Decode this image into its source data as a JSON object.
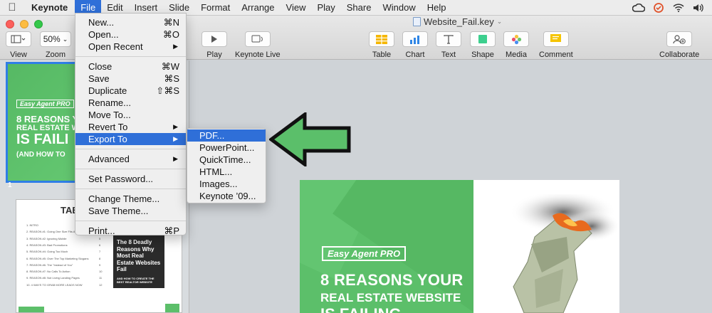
{
  "menubar": {
    "app_name": "Keynote",
    "items": [
      "File",
      "Edit",
      "Insert",
      "Slide",
      "Format",
      "Arrange",
      "View",
      "Play",
      "Share",
      "Window",
      "Help"
    ]
  },
  "window": {
    "document_title": "Website_Fail.key"
  },
  "toolbar": {
    "view_label": "View",
    "zoom_value": "50%",
    "zoom_label": "Zoom",
    "play_label": "Play",
    "keynote_live_label": "Keynote Live",
    "table_label": "Table",
    "chart_label": "Chart",
    "text_label": "Text",
    "shape_label": "Shape",
    "media_label": "Media",
    "comment_label": "Comment",
    "collaborate_label": "Collaborate"
  },
  "file_menu": {
    "items": [
      {
        "label": "New...",
        "shortcut": "⌘N"
      },
      {
        "label": "Open...",
        "shortcut": "⌘O"
      },
      {
        "label": "Open Recent",
        "submenu": true
      },
      {
        "label": "Close",
        "shortcut": "⌘W"
      },
      {
        "label": "Save",
        "shortcut": "⌘S"
      },
      {
        "label": "Duplicate",
        "shortcut": "⇧⌘S"
      },
      {
        "label": "Rename..."
      },
      {
        "label": "Move To..."
      },
      {
        "label": "Revert To",
        "submenu": true
      },
      {
        "label": "Export To",
        "submenu": true,
        "highlighted": true
      },
      {
        "label": "Advanced",
        "submenu": true
      },
      {
        "label": "Set Password..."
      },
      {
        "label": "Change Theme..."
      },
      {
        "label": "Save Theme..."
      },
      {
        "label": "Print...",
        "shortcut": "⌘P"
      }
    ]
  },
  "export_submenu": {
    "items": [
      "PDF...",
      "PowerPoint...",
      "QuickTime...",
      "HTML...",
      "Images...",
      "Keynote ’09..."
    ]
  },
  "slides": {
    "slide1_number": "1",
    "slide1_logo": "Easy Agent PRO",
    "slide1_line1": "8 REASONS YO",
    "slide1_line2": "REAL ESTATE WE",
    "slide1_line3": "IS FAILI",
    "slide1_line4": "(AND HOW TO",
    "slide2_title": "TAB",
    "slide2_toc": [
      "1. INTRO",
      "2. REASON #1: Going One Size Fits All",
      "3. REASON #2: Ignoring Mobile",
      "4. REASON #3: Bad Promotions",
      "5. REASON #4: Going Too Much",
      "6. REASON #5: Over The Top Marketing Slogans",
      "7. REASON #6: The \"Instead of You\"",
      "8. REASON #7: No Calls To Action",
      "9. REASON #8: Not Living Landing Pages",
      "10. 4 WAYS TO GRAB MORE LEADS NOW"
    ],
    "slide2_page_numbers": [
      "3",
      "3",
      "5",
      "6",
      "7",
      "8",
      "9",
      "10",
      "11",
      "12"
    ],
    "slide2_book": "The 8 Deadly Reasons Why Most Real Estate Websites Fail",
    "slide2_book_sub": "AND HOW TO CREATE THE BEST REALTOR WEBSITE"
  },
  "canvas": {
    "logo": "Easy Agent PRO",
    "headline1": "8 REASONS YOUR",
    "headline2": "REAL ESTATE WEBSITE",
    "headline3": "IS FAILING"
  },
  "colors": {
    "menu_highlight": "#2f6fd8",
    "slide_green": "#5cbf6a",
    "arrow_green": "#5bbf6a"
  }
}
